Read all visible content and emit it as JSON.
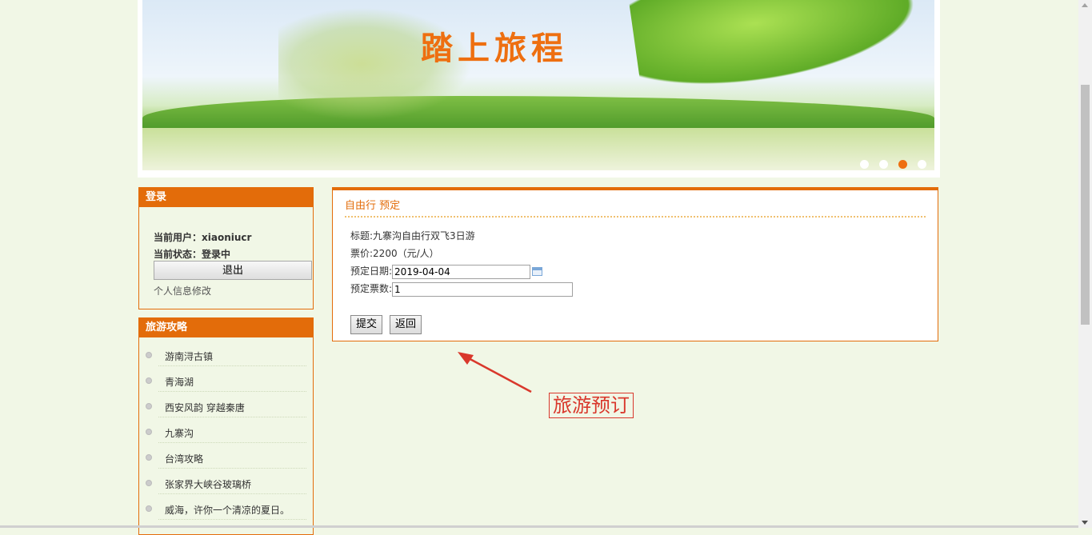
{
  "banner": {
    "title": "踏上旅程",
    "slides": [
      {
        "active": false
      },
      {
        "active": false
      },
      {
        "active": true
      },
      {
        "active": false
      }
    ]
  },
  "login": {
    "heading": "登录",
    "user_line": "当前用户：xiaoniucr",
    "status_line": "当前状态：登录中",
    "logout_label": "退出",
    "profile_link": "个人信息修改"
  },
  "guides": {
    "heading": "旅游攻略",
    "items": [
      "游南浔古镇",
      "青海湖",
      "西安风韵 穿越秦唐",
      "九寨沟",
      "台湾攻略",
      "张家界大峡谷玻璃桥",
      "威海，许你一个清凉的夏日。"
    ]
  },
  "booking": {
    "heading": "自由行 预定",
    "title_line": "标题:九寨沟自由行双飞3日游",
    "price_line": "票价:2200（元/人）",
    "date_label": "预定日期:",
    "date_value": "2019-04-04",
    "qty_label": "预定票数:",
    "qty_value": "1",
    "submit_label": "提交",
    "back_label": "返回"
  },
  "annotation": {
    "text": "旅游预订"
  },
  "colors": {
    "accent": "#e36c0a",
    "page_bg": "#f1f7e6",
    "annotation": "#d9382c"
  }
}
